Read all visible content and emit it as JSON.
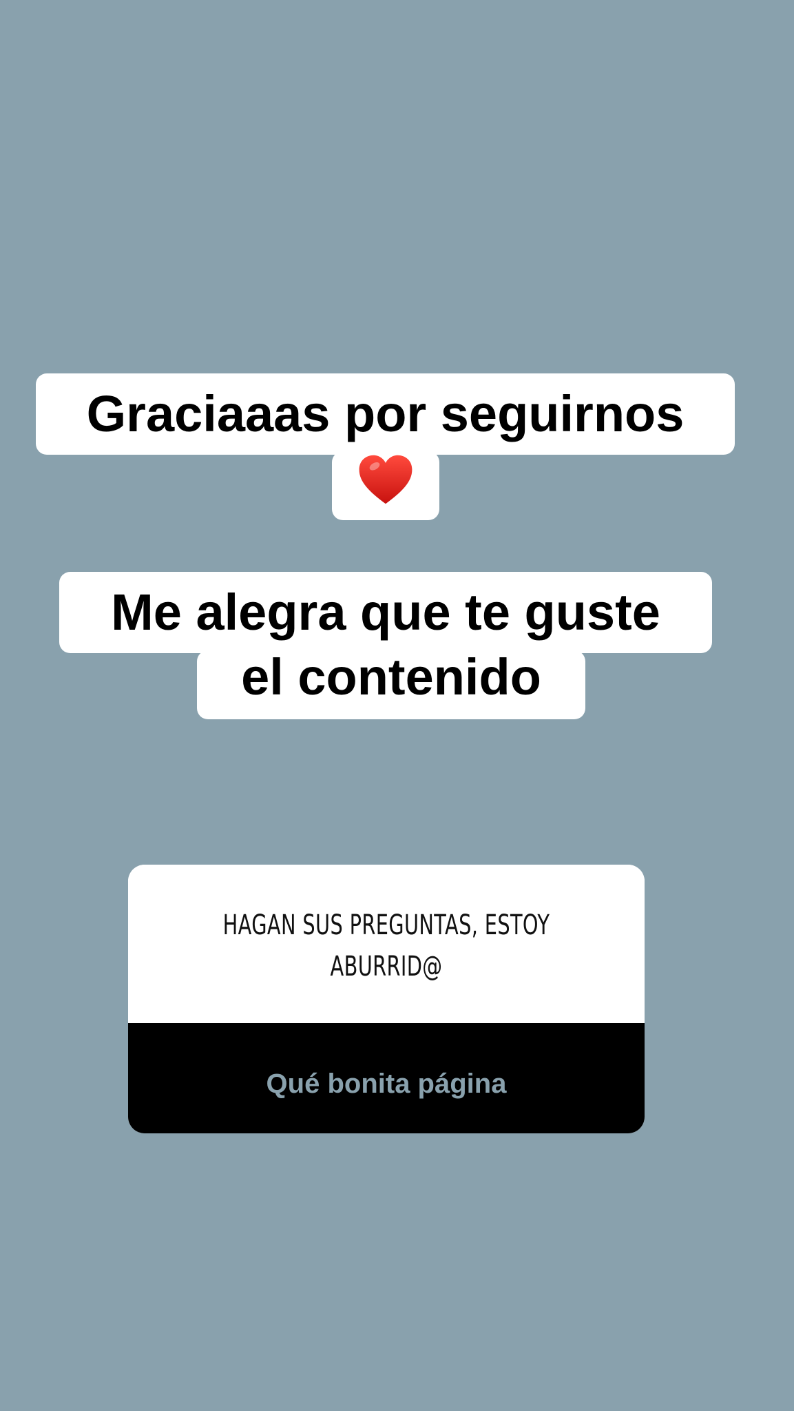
{
  "story": {
    "background_color": "#89a1ad",
    "text_lines": [
      {
        "text": "Graciaaas por seguirnos"
      },
      {
        "text": "Me alegra que te guste"
      },
      {
        "text": "el contenido"
      }
    ],
    "emoji_icon": "heart-emoji",
    "emoji_color": "#e0211c"
  },
  "question_sticker": {
    "question_lines": [
      "HAGAN SUS PREGUNTAS, ESTOY",
      "ABURRID@"
    ],
    "answer": "Qué bonita página",
    "answer_bg": "#000000",
    "answer_text_color": "#89a1ad"
  }
}
